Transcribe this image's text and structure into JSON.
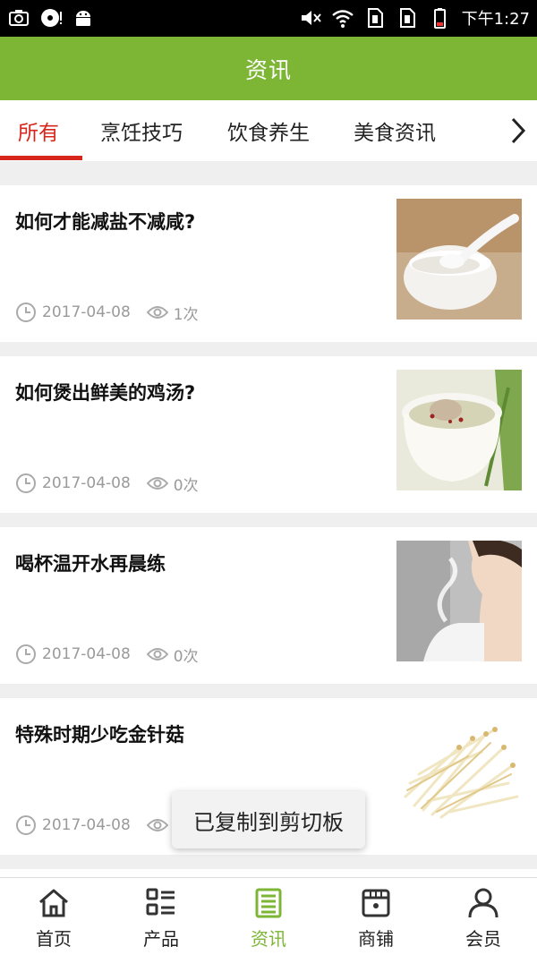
{
  "status_bar": {
    "time": "下午1:27"
  },
  "header": {
    "title": "资讯"
  },
  "tabs": [
    {
      "label": "所有"
    },
    {
      "label": "烹饪技巧"
    },
    {
      "label": "饮食养生"
    },
    {
      "label": "美食资讯"
    }
  ],
  "articles": [
    {
      "title": "如何才能减盐不减咸?",
      "date": "2017-04-08",
      "views": "1次"
    },
    {
      "title": "如何煲出鲜美的鸡汤?",
      "date": "2017-04-08",
      "views": "0次"
    },
    {
      "title": "喝杯温开水再晨练",
      "date": "2017-04-08",
      "views": "0次"
    },
    {
      "title": "特殊时期少吃金针菇",
      "date": "2017-04-08",
      "views": ""
    }
  ],
  "toast": {
    "text": "已复制到剪切板"
  },
  "bottom_nav": [
    {
      "label": "首页",
      "icon": "home-icon"
    },
    {
      "label": "产品",
      "icon": "list-icon"
    },
    {
      "label": "资讯",
      "icon": "news-icon"
    },
    {
      "label": "商铺",
      "icon": "store-icon"
    },
    {
      "label": "会员",
      "icon": "user-icon"
    }
  ],
  "colors": {
    "accent_green": "#7cb634",
    "tab_active_red": "#d7261c"
  }
}
